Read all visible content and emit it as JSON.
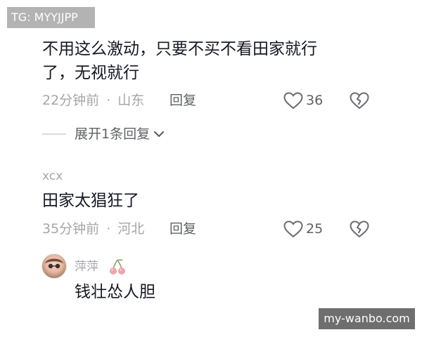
{
  "watermarks": {
    "top_left": "TG: MYYJJPP",
    "bottom_right": "my-wanbo.com"
  },
  "comments": [
    {
      "text_line1": "不用这么激动，只要不买不看田家就行",
      "text_line2": "了，无视就行",
      "time": "22分钟前",
      "location": "山东",
      "reply_label": "回复",
      "likes": "36",
      "expand_label": "展开1条回复"
    },
    {
      "username": "xcx",
      "text": "田家太猖狂了",
      "time": "35分钟前",
      "location": "河北",
      "reply_label": "回复",
      "likes": "25"
    }
  ],
  "reply": {
    "username": "萍萍",
    "text": "钱壮怂人胆"
  },
  "separator": "·",
  "colors": {
    "text": "#161823",
    "meta": "#a5a6ab",
    "action": "#5f6066"
  }
}
